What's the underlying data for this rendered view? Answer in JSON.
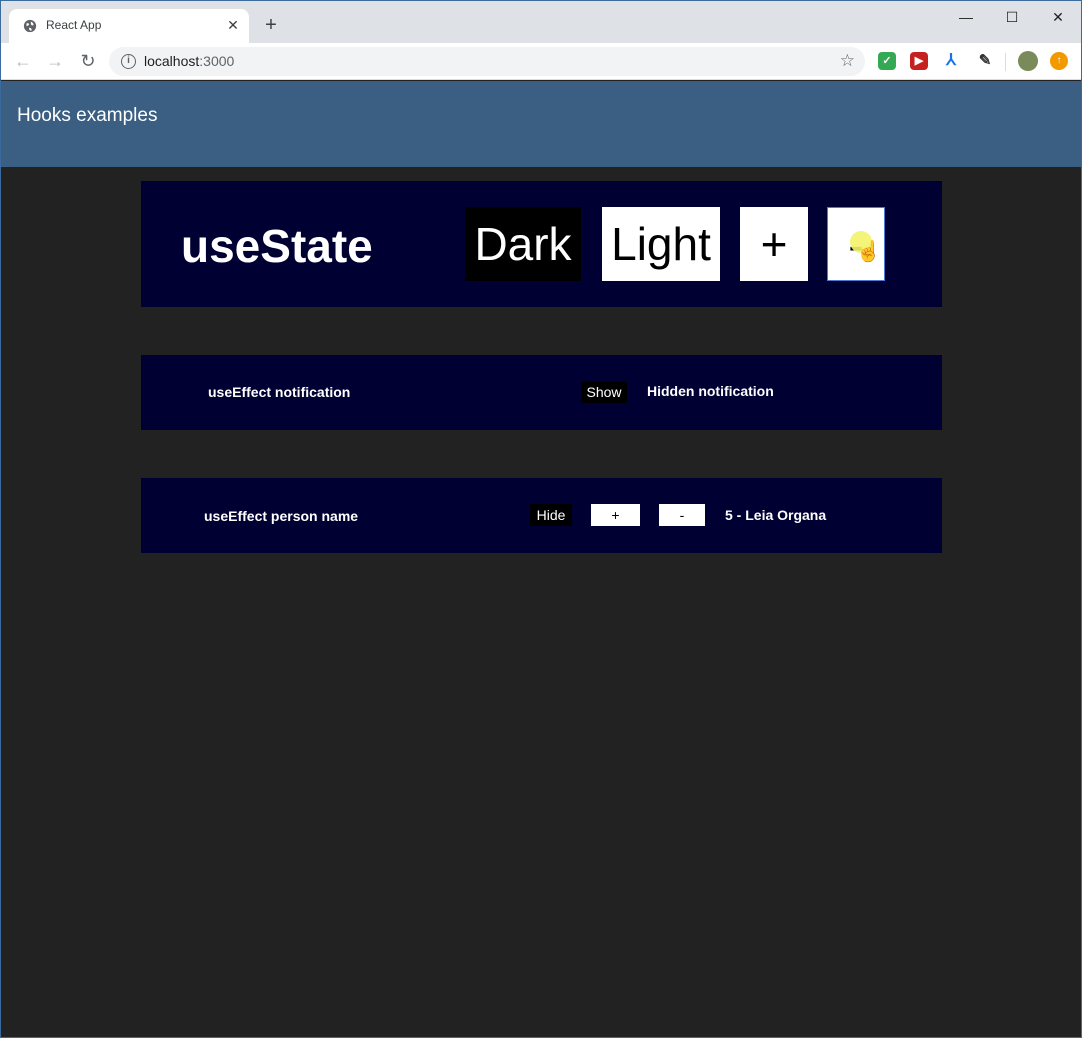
{
  "browser": {
    "tab_title": "React App",
    "tab_close": "✕",
    "new_tab": "+",
    "window_controls": {
      "minimize": "—",
      "maximize": "☐",
      "close": "✕"
    },
    "nav": {
      "back": "←",
      "forward": "→",
      "reload": "↻"
    },
    "url_host": "localhost",
    "url_port": ":3000",
    "icons": [
      "globe-icon",
      "info-icon",
      "star-icon",
      "shield-extension-icon",
      "pdf-extension-icon",
      "acrobat-extension-icon",
      "eyedropper-extension-icon",
      "profile-avatar",
      "update-icon"
    ]
  },
  "app": {
    "header_title": "Hooks examples",
    "use_state": {
      "title": "useState",
      "dark_label": "Dark",
      "light_label": "Light",
      "plus_label": "+",
      "minus_label": "-"
    },
    "effect_notification": {
      "label": "useEffect notification",
      "show_label": "Show",
      "status": "Hidden notification"
    },
    "effect_person": {
      "label": "useEffect person name",
      "hide_label": "Hide",
      "plus_label": "+",
      "minus_label": "-",
      "result": "5 - Leia Organa"
    }
  },
  "colors": {
    "header_bg": "#3a5f83",
    "panel_bg": "#000033",
    "page_bg": "#222222"
  }
}
